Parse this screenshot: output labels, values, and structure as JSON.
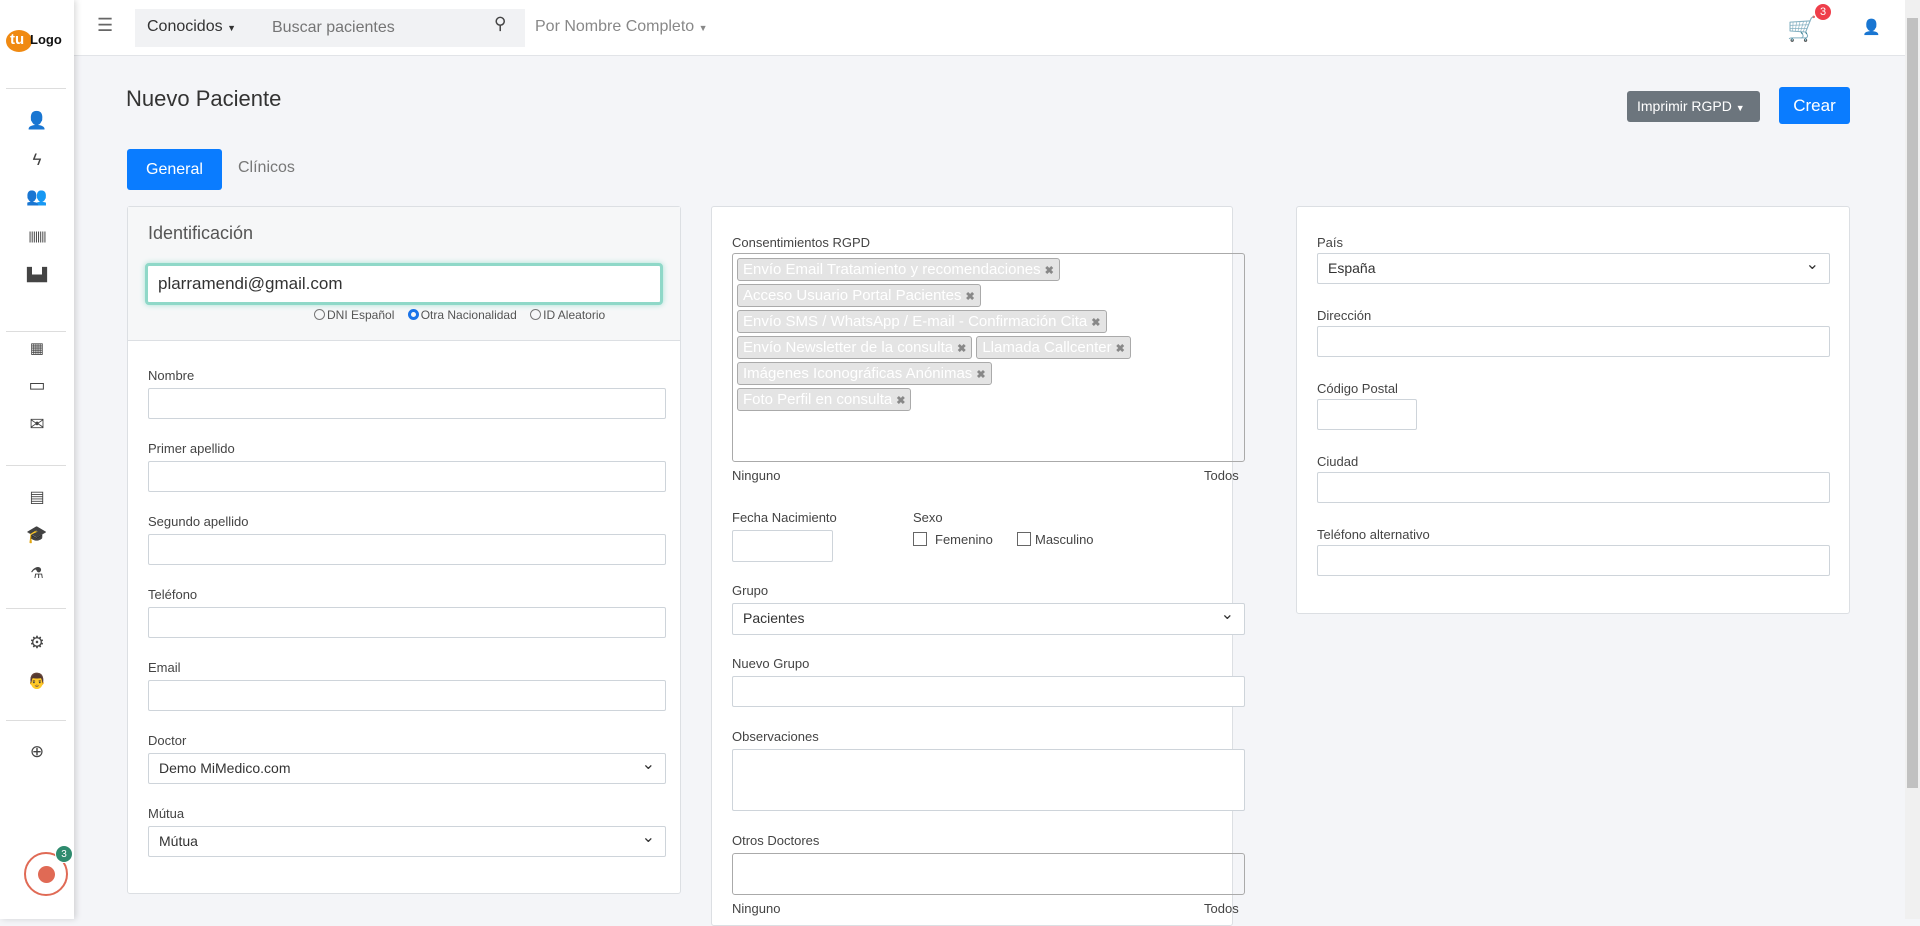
{
  "logo": "tulogo",
  "topbar": {
    "known_filter": "Conocidos",
    "search_placeholder": "Buscar pacientes",
    "search_mode": "Por Nombre Completo",
    "cart_count": "3"
  },
  "sidebar": {
    "icons": [
      "user-icon",
      "bolt-icon",
      "users-icon",
      "barcode-icon",
      "chart-icon",
      "calendar-icon",
      "credit-card-icon",
      "envelope-icon",
      "newspaper-icon",
      "graduation-cap-icon",
      "flask-icon",
      "cogs-icon",
      "doctor-icon",
      "lifebuoy-icon"
    ],
    "record_badge": "3"
  },
  "page": {
    "title": "Nuevo Paciente",
    "print_button": "Imprimir RGPD",
    "create_button": "Crear",
    "tabs": [
      "General",
      "Clínicos"
    ]
  },
  "identification": {
    "title": "Identificación",
    "value": "plarramendi@gmail.com",
    "options": [
      "DNI Español",
      "Otra Nacionalidad",
      "ID Aleatorio"
    ],
    "selected": "Otra Nacionalidad"
  },
  "left_fields": [
    {
      "label": "Nombre",
      "value": ""
    },
    {
      "label": "Primer apellido",
      "value": ""
    },
    {
      "label": "Segundo apellido",
      "value": ""
    },
    {
      "label": "Teléfono",
      "value": ""
    },
    {
      "label": "Email",
      "value": ""
    },
    {
      "label": "Doctor",
      "value": "Demo MiMedico.com",
      "select": true
    },
    {
      "label": "Mútua",
      "value": "Mútua",
      "select": true
    }
  ],
  "consents": {
    "label": "Consentimientos RGPD",
    "tags": [
      "Envío Email Tratamiento y recomendaciones",
      "Acceso Usuario Portal Pacientes",
      "Envío SMS / WhatsApp / E-mail - Confirmación Cita",
      "Envío Newsletter de la consulta",
      "Llamada Callcenter",
      "Imágenes Iconográficas Anónimas",
      "Foto Perfil en consulta"
    ],
    "none": "Ninguno",
    "all": "Todos"
  },
  "middle": {
    "birth_label": "Fecha Nacimiento",
    "sex_label": "Sexo",
    "female": "Femenino",
    "male": "Masculino",
    "group_label": "Grupo",
    "group_value": "Pacientes",
    "new_group_label": "Nuevo Grupo",
    "notes_label": "Observaciones",
    "other_doctors_label": "Otros Doctores",
    "none": "Ninguno",
    "all": "Todos"
  },
  "right": {
    "country_label": "País",
    "country_value": "España",
    "address_label": "Dirección",
    "zip_label": "Código Postal",
    "city_label": "Ciudad",
    "alt_phone_label": "Teléfono alternativo"
  }
}
